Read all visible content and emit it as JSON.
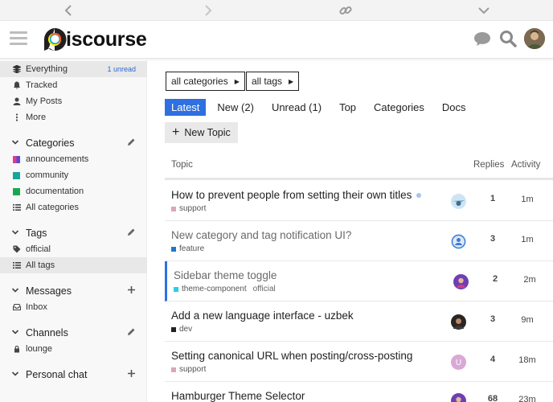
{
  "header": {
    "logo_text": "iscourse"
  },
  "sidebar": {
    "top_items": [
      {
        "label": "Everything",
        "badge": "1 unread",
        "icon": "stack-icon"
      },
      {
        "label": "Tracked",
        "icon": "bell-icon"
      },
      {
        "label": "My Posts",
        "icon": "user-icon"
      },
      {
        "label": "More",
        "icon": "ellipsis-v-icon"
      }
    ],
    "categories": {
      "title": "Categories",
      "items": [
        {
          "label": "announcements",
          "color": "#8e3fcf"
        },
        {
          "label": "community",
          "color": "#16a79a"
        },
        {
          "label": "documentation",
          "color": "#1aa84e"
        },
        {
          "label": "All categories"
        }
      ]
    },
    "tags": {
      "title": "Tags",
      "items": [
        {
          "label": "official"
        },
        {
          "label": "All tags"
        }
      ]
    },
    "messages": {
      "title": "Messages",
      "items": [
        {
          "label": "Inbox"
        }
      ]
    },
    "channels": {
      "title": "Channels",
      "items": [
        {
          "label": "lounge"
        }
      ]
    },
    "personal_chat": {
      "title": "Personal chat"
    }
  },
  "filters": {
    "categories": "all categories",
    "tags": "all tags"
  },
  "nav": {
    "tabs": [
      "Latest",
      "New (2)",
      "Unread (1)",
      "Top",
      "Categories",
      "Docs"
    ]
  },
  "new_topic_label": "New Topic",
  "table": {
    "col_topic": "Topic",
    "col_replies": "Replies",
    "col_activity": "Activity",
    "rows": [
      {
        "title": "How to prevent people from setting their own titles",
        "category": "support",
        "category_color": "#d8a8b8",
        "tag": "",
        "replies": "1",
        "activity": "1m",
        "unread_dot": true
      },
      {
        "title": "New category and tag notification UI?",
        "category": "feature",
        "category_color": "#1f78c8",
        "tag": "",
        "replies": "3",
        "activity": "1m"
      },
      {
        "title": "Sidebar theme toggle",
        "category": "theme-component",
        "category_color": "#28d0e0",
        "tag": "official",
        "replies": "2",
        "activity": "2m"
      },
      {
        "title": "Add a new language interface - uzbek",
        "category": "dev",
        "category_color": "#222222",
        "tag": "",
        "replies": "3",
        "activity": "9m"
      },
      {
        "title": "Setting canonical URL when posting/cross-posting",
        "category": "support",
        "category_color": "#d8a8b8",
        "tag": "",
        "replies": "4",
        "activity": "18m"
      },
      {
        "title": "Hamburger Theme Selector",
        "category": "",
        "category_color": "#ffffff",
        "tag": "",
        "replies": "68",
        "activity": "23m"
      }
    ]
  }
}
